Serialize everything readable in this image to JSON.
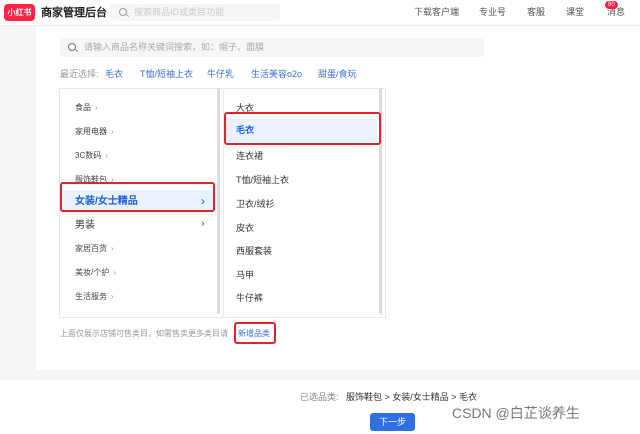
{
  "topbar": {
    "logo": "小红书",
    "brand": "商家管理后台",
    "search_placeholder": "搜索商品ID或类目功能",
    "nav": [
      "下载客户端",
      "专业号",
      "客服",
      "课堂",
      "消息"
    ],
    "badge": "80"
  },
  "search": {
    "placeholder": "请输入商品名称关键词搜索，如：帽子、面膜"
  },
  "recent": {
    "label": "最近选择:",
    "items": [
      "毛衣",
      "T恤/短袖上衣",
      "牛仔乳",
      "生活美容o2o",
      "甜蛋/食玩"
    ]
  },
  "level1": {
    "items": [
      "食品",
      "家用电器",
      "3C数码",
      "服饰鞋包"
    ],
    "selected": "女装/女士精品",
    "big_item": "男装",
    "items_after": [
      "家居百货",
      "美妆/个护",
      "生活服务"
    ]
  },
  "level2": {
    "first": "大衣",
    "selected": "毛衣",
    "items": [
      "连衣裙",
      "T恤/短袖上衣",
      "卫衣/绒衫",
      "皮衣",
      "西服套装",
      "马甲",
      "牛仔裤"
    ]
  },
  "footer": {
    "note": "上面仅展示店铺可售类目，如需售卖更多类目请",
    "link": "新增品类"
  },
  "bottom": {
    "selected_label": "已选品类:",
    "selected_path": "服饰鞋包 > 女装/女士精品 > 毛衣",
    "next_button": "下一步"
  },
  "watermark": "CSDN @白芷谈养生",
  "colors": {
    "accent": "#1f5fe0",
    "brand": "#ff2442",
    "highlight_box": "#e0242b"
  }
}
